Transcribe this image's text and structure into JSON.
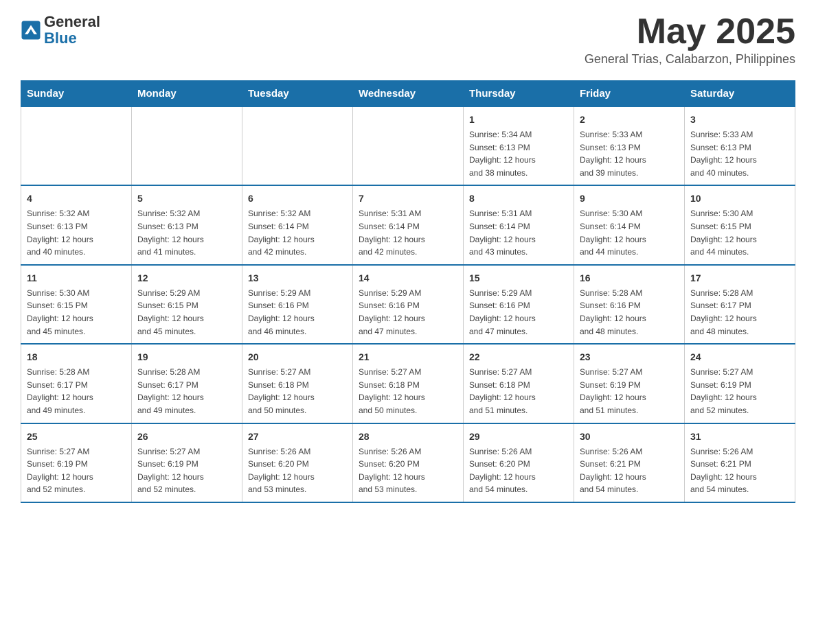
{
  "header": {
    "logo_text_1": "General",
    "logo_text_2": "Blue",
    "month_title": "May 2025",
    "location": "General Trias, Calabarzon, Philippines"
  },
  "days_of_week": [
    "Sunday",
    "Monday",
    "Tuesday",
    "Wednesday",
    "Thursday",
    "Friday",
    "Saturday"
  ],
  "weeks": [
    [
      {
        "day": "",
        "info": ""
      },
      {
        "day": "",
        "info": ""
      },
      {
        "day": "",
        "info": ""
      },
      {
        "day": "",
        "info": ""
      },
      {
        "day": "1",
        "info": "Sunrise: 5:34 AM\nSunset: 6:13 PM\nDaylight: 12 hours\nand 38 minutes."
      },
      {
        "day": "2",
        "info": "Sunrise: 5:33 AM\nSunset: 6:13 PM\nDaylight: 12 hours\nand 39 minutes."
      },
      {
        "day": "3",
        "info": "Sunrise: 5:33 AM\nSunset: 6:13 PM\nDaylight: 12 hours\nand 40 minutes."
      }
    ],
    [
      {
        "day": "4",
        "info": "Sunrise: 5:32 AM\nSunset: 6:13 PM\nDaylight: 12 hours\nand 40 minutes."
      },
      {
        "day": "5",
        "info": "Sunrise: 5:32 AM\nSunset: 6:13 PM\nDaylight: 12 hours\nand 41 minutes."
      },
      {
        "day": "6",
        "info": "Sunrise: 5:32 AM\nSunset: 6:14 PM\nDaylight: 12 hours\nand 42 minutes."
      },
      {
        "day": "7",
        "info": "Sunrise: 5:31 AM\nSunset: 6:14 PM\nDaylight: 12 hours\nand 42 minutes."
      },
      {
        "day": "8",
        "info": "Sunrise: 5:31 AM\nSunset: 6:14 PM\nDaylight: 12 hours\nand 43 minutes."
      },
      {
        "day": "9",
        "info": "Sunrise: 5:30 AM\nSunset: 6:14 PM\nDaylight: 12 hours\nand 44 minutes."
      },
      {
        "day": "10",
        "info": "Sunrise: 5:30 AM\nSunset: 6:15 PM\nDaylight: 12 hours\nand 44 minutes."
      }
    ],
    [
      {
        "day": "11",
        "info": "Sunrise: 5:30 AM\nSunset: 6:15 PM\nDaylight: 12 hours\nand 45 minutes."
      },
      {
        "day": "12",
        "info": "Sunrise: 5:29 AM\nSunset: 6:15 PM\nDaylight: 12 hours\nand 45 minutes."
      },
      {
        "day": "13",
        "info": "Sunrise: 5:29 AM\nSunset: 6:16 PM\nDaylight: 12 hours\nand 46 minutes."
      },
      {
        "day": "14",
        "info": "Sunrise: 5:29 AM\nSunset: 6:16 PM\nDaylight: 12 hours\nand 47 minutes."
      },
      {
        "day": "15",
        "info": "Sunrise: 5:29 AM\nSunset: 6:16 PM\nDaylight: 12 hours\nand 47 minutes."
      },
      {
        "day": "16",
        "info": "Sunrise: 5:28 AM\nSunset: 6:16 PM\nDaylight: 12 hours\nand 48 minutes."
      },
      {
        "day": "17",
        "info": "Sunrise: 5:28 AM\nSunset: 6:17 PM\nDaylight: 12 hours\nand 48 minutes."
      }
    ],
    [
      {
        "day": "18",
        "info": "Sunrise: 5:28 AM\nSunset: 6:17 PM\nDaylight: 12 hours\nand 49 minutes."
      },
      {
        "day": "19",
        "info": "Sunrise: 5:28 AM\nSunset: 6:17 PM\nDaylight: 12 hours\nand 49 minutes."
      },
      {
        "day": "20",
        "info": "Sunrise: 5:27 AM\nSunset: 6:18 PM\nDaylight: 12 hours\nand 50 minutes."
      },
      {
        "day": "21",
        "info": "Sunrise: 5:27 AM\nSunset: 6:18 PM\nDaylight: 12 hours\nand 50 minutes."
      },
      {
        "day": "22",
        "info": "Sunrise: 5:27 AM\nSunset: 6:18 PM\nDaylight: 12 hours\nand 51 minutes."
      },
      {
        "day": "23",
        "info": "Sunrise: 5:27 AM\nSunset: 6:19 PM\nDaylight: 12 hours\nand 51 minutes."
      },
      {
        "day": "24",
        "info": "Sunrise: 5:27 AM\nSunset: 6:19 PM\nDaylight: 12 hours\nand 52 minutes."
      }
    ],
    [
      {
        "day": "25",
        "info": "Sunrise: 5:27 AM\nSunset: 6:19 PM\nDaylight: 12 hours\nand 52 minutes."
      },
      {
        "day": "26",
        "info": "Sunrise: 5:27 AM\nSunset: 6:19 PM\nDaylight: 12 hours\nand 52 minutes."
      },
      {
        "day": "27",
        "info": "Sunrise: 5:26 AM\nSunset: 6:20 PM\nDaylight: 12 hours\nand 53 minutes."
      },
      {
        "day": "28",
        "info": "Sunrise: 5:26 AM\nSunset: 6:20 PM\nDaylight: 12 hours\nand 53 minutes."
      },
      {
        "day": "29",
        "info": "Sunrise: 5:26 AM\nSunset: 6:20 PM\nDaylight: 12 hours\nand 54 minutes."
      },
      {
        "day": "30",
        "info": "Sunrise: 5:26 AM\nSunset: 6:21 PM\nDaylight: 12 hours\nand 54 minutes."
      },
      {
        "day": "31",
        "info": "Sunrise: 5:26 AM\nSunset: 6:21 PM\nDaylight: 12 hours\nand 54 minutes."
      }
    ]
  ]
}
